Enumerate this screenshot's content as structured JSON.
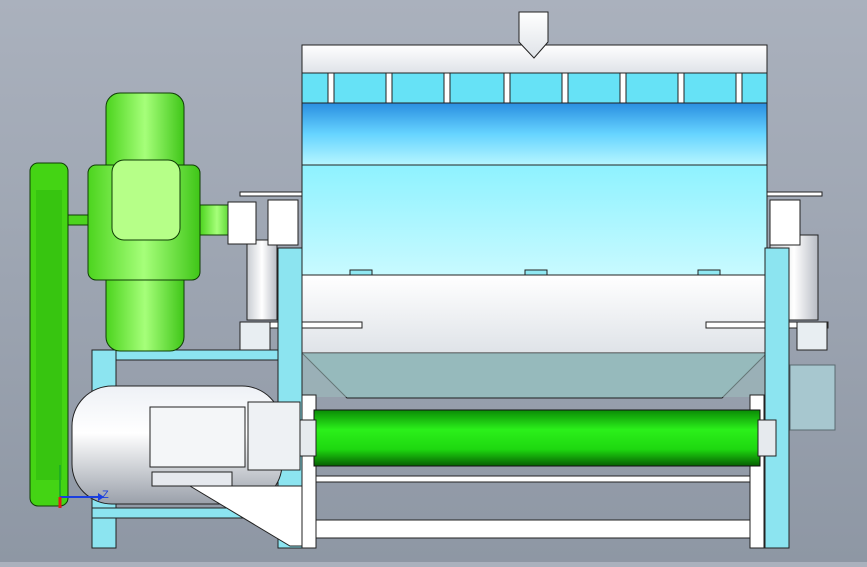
{
  "viewport": {
    "background_top": "#aab1bd",
    "background_bottom": "#8e97a4"
  },
  "triad": {
    "z_label": "Z",
    "x_color": "#e01a1a",
    "z_color": "#1a3fe0",
    "y_color": "#20b020"
  },
  "colors": {
    "frame_cyan": "#8ce4f0",
    "drum_blue": "#4fc0f0",
    "drum_light": "#a6f4ff",
    "part_green": "#66ee33",
    "roller_green": "#22dd11",
    "motor_silver": "#d8dde6",
    "outline": "#1a1a1a"
  }
}
